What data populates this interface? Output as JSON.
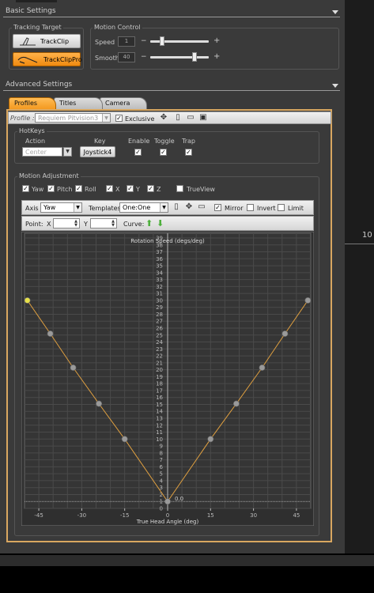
{
  "basic": {
    "title": "Basic Settings",
    "tracking_title": "Tracking Target",
    "trackclip": "TrackClip",
    "trackclippro": "TrackClipPro",
    "motion_title": "Motion Control",
    "speed_label": "Speed",
    "speed_value": "1",
    "smooth_label": "Smooth",
    "smooth_value": "40",
    "minus": "−",
    "plus": "+"
  },
  "advanced": {
    "title": "Advanced Settings"
  },
  "tabs": [
    "Profiles",
    "Titles",
    "Camera"
  ],
  "profile": {
    "label": "Profile :",
    "value": "Requiem Pitvision3",
    "exclusive": "Exclusive"
  },
  "hotkeys": {
    "title": "HotKeys",
    "col_action": "Action",
    "col_key": "Key",
    "col_enable": "Enable",
    "col_toggle": "Toggle",
    "col_trap": "Trap",
    "action_value": "Center",
    "key_value": "Joystick4"
  },
  "motion": {
    "title": "Motion Adjustment",
    "axes": [
      "Yaw",
      "Pitch",
      "Roll",
      "X",
      "Y",
      "Z"
    ],
    "trueview": "TrueView"
  },
  "curve_toolbar": {
    "axis_label": "Axis",
    "axis_value": "Yaw",
    "templates_label": "Templates",
    "templates_value": "One:One",
    "mirror": "Mirror",
    "invert": "Invert",
    "limit": "Limit",
    "point_label": "Point:",
    "x_label": "X",
    "y_label": "Y",
    "curve_label": "Curve:"
  },
  "right_label": "10",
  "chart_data": {
    "type": "line",
    "title": "Rotation Speed (degs/deg)",
    "xlabel": "True Head Angle (deg)",
    "ylabel": "",
    "xlim": [
      -50,
      50
    ],
    "ylim": [
      0,
      39
    ],
    "x_ticks": [
      -45,
      -30,
      -15,
      0,
      15,
      30,
      45
    ],
    "y_ticks": [
      0,
      1,
      2,
      3,
      4,
      5,
      6,
      7,
      8,
      9,
      10,
      11,
      12,
      13,
      14,
      15,
      16,
      17,
      18,
      19,
      20,
      21,
      22,
      23,
      24,
      25,
      26,
      27,
      28,
      29,
      30,
      31,
      32,
      33,
      34,
      35,
      36,
      37,
      38,
      39
    ],
    "x": [
      -49,
      -41,
      -33,
      -24,
      -15,
      0,
      15,
      24,
      33,
      41,
      49
    ],
    "y": [
      30,
      25.2,
      20.3,
      15.1,
      10,
      1,
      10,
      15.1,
      20.3,
      25.2,
      30
    ],
    "origin_label": "0.0",
    "line_color": "#e0a040",
    "point_color": "#9a9a9a",
    "grid": true
  }
}
